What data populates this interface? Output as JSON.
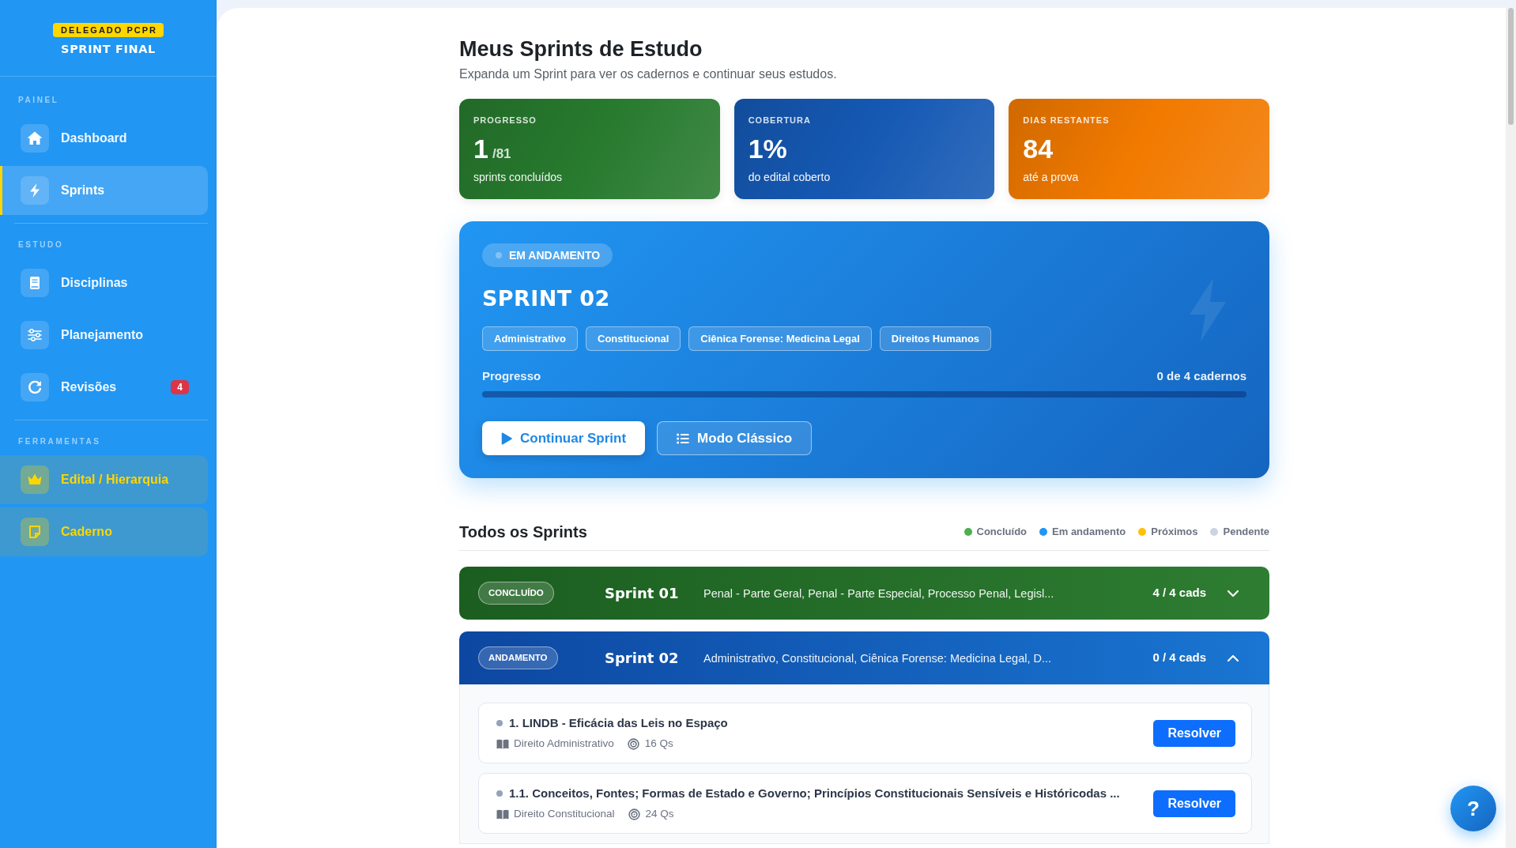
{
  "sidebar": {
    "brand": {
      "badge": "DELEGADO PCPR",
      "title": "SPRINT FINAL"
    },
    "sections": [
      {
        "heading": "PAINEL",
        "items": [
          {
            "label": "Dashboard",
            "kind": "link",
            "selected": false
          },
          {
            "label": "Sprints",
            "kind": "link",
            "selected": true
          }
        ]
      },
      {
        "heading": "ESTUDO",
        "items": [
          {
            "label": "Disciplinas",
            "kind": "link",
            "selected": false
          },
          {
            "label": "Planejamento",
            "kind": "link",
            "selected": false
          },
          {
            "label": "Revisões",
            "kind": "link",
            "selected": false,
            "badge": "4"
          }
        ]
      },
      {
        "heading": "FERRAMENTAS",
        "items": [
          {
            "label": "Edital / Hierarquia",
            "kind": "tool",
            "selected": false
          },
          {
            "label": "Caderno",
            "kind": "tool",
            "selected": false
          }
        ]
      }
    ]
  },
  "header": {
    "title": "Meus Sprints de Estudo",
    "subtitle": "Expanda um Sprint para ver os cadernos e continuar seus estudos."
  },
  "stats": [
    {
      "label": "PROGRESSO",
      "value": "1",
      "unit": "/81",
      "caption": "sprints concluídos",
      "color": "#277a2e"
    },
    {
      "label": "COBERTURA",
      "value": "1%",
      "caption": "do edital coberto",
      "color": "#1559b4"
    },
    {
      "label": "DIAS RESTANTES",
      "value": "84",
      "caption": "até a prova",
      "color": "#f27a00"
    }
  ],
  "current_sprint": {
    "status": "EM ANDAMENTO",
    "title": "SPRINT 02",
    "tags": [
      "Administrativo",
      "Constitucional",
      "Ciênica Forense: Medicina Legal",
      "Direitos Humanos"
    ],
    "progress_label": "Progresso",
    "progress_text": "0 de 4 cadernos",
    "level": 0,
    "buttons": [
      {
        "label": "Continuar Sprint",
        "kind": "primary"
      },
      {
        "label": "Modo Clássico",
        "kind": "outline"
      }
    ]
  },
  "all_sprints": {
    "title": "Todos os Sprints",
    "legend": [
      {
        "label": "Concluído",
        "color": "#4caf50"
      },
      {
        "label": "Em andamento",
        "color": "#2196f3"
      },
      {
        "label": "Próximos",
        "color": "#ffc107"
      },
      {
        "label": "Pendente",
        "color": "#cbd5e1"
      }
    ],
    "sprints": [
      {
        "kind": "completed",
        "status": "CONCLUÍDO",
        "title": "Sprint 01",
        "subjects": "Penal - Parte Geral, Penal - Parte Especial, Processo Penal, Legisl...",
        "count": "4 / 4 cads",
        "expanded": false
      },
      {
        "kind": "in_progress",
        "status": "ANDAMENTO",
        "title": "Sprint 02",
        "subjects": "Administrativo, Constitucional, Ciênica Forense: Medicina Legal, D...",
        "count": "0 / 4 cads",
        "expanded": true,
        "notebooks": [
          {
            "title": "1. LINDB - Eficácia das Leis no Espaço",
            "done": false,
            "subject": "Direito Administrativo",
            "questions": "16 Qs",
            "button": "Resolver"
          },
          {
            "title": "1.1. Conceitos, Fontes; Formas de Estado e Governo; Princípios Constitucionais Sensíveis e Históricodas ...",
            "done": false,
            "subject": "Direito Constitucional",
            "questions": "24 Qs",
            "button": "Resolver"
          }
        ]
      }
    ]
  },
  "help_button": {
    "label": "?"
  }
}
